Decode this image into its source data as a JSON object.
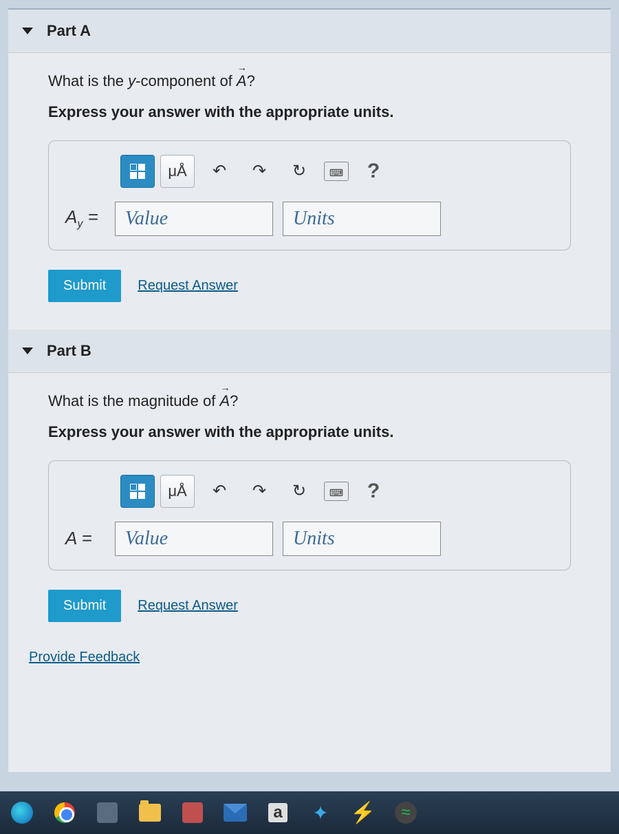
{
  "parts": [
    {
      "id": "A",
      "header": "Part A",
      "question_prefix": "What is the ",
      "question_var": "y",
      "question_mid": "-component of ",
      "question_vec": "A",
      "question_suffix": "?",
      "instruction": "Express your answer with the appropriate units.",
      "special_label": "μÅ",
      "var_html": "A<sub>y</sub> =",
      "value_placeholder": "Value",
      "units_placeholder": "Units",
      "submit": "Submit",
      "request": "Request Answer"
    },
    {
      "id": "B",
      "header": "Part B",
      "question_prefix": "What is the magnitude of ",
      "question_var": "",
      "question_mid": "",
      "question_vec": "A",
      "question_suffix": "?",
      "instruction": "Express your answer with the appropriate units.",
      "special_label": "μÅ",
      "var_html": "A =",
      "value_placeholder": "Value",
      "units_placeholder": "Units",
      "submit": "Submit",
      "request": "Request Answer"
    }
  ],
  "feedback": "Provide Feedback",
  "help": "?",
  "amz": "a"
}
